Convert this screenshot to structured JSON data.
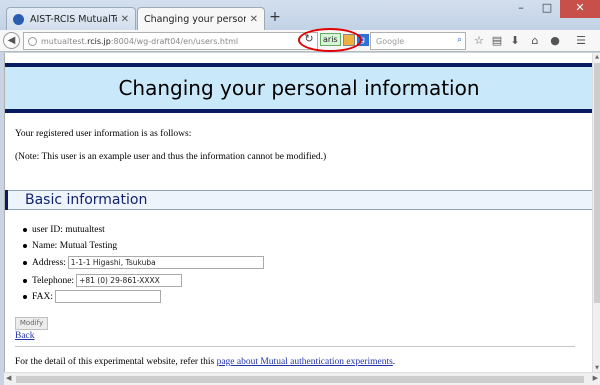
{
  "browser": {
    "tabs": [
      {
        "label": "AIST-RCIS MutualTestF...",
        "active": false
      },
      {
        "label": "Changing your personal info...",
        "active": true
      }
    ],
    "new_tab_symbol": "+",
    "url": {
      "prefix": "mutualtest.",
      "host": "rcis.jp",
      "rest": ":8004/wg-draft04/en/users.html"
    },
    "addon_label": "aris",
    "search_placeholder": "Google",
    "icons": [
      "back-icon",
      "reload-icon",
      "search-icon",
      "star-icon",
      "reading-list-icon",
      "download-icon",
      "home-icon",
      "chat-icon",
      "menu-icon"
    ]
  },
  "page": {
    "title": "Changing your personal information",
    "intro1": "Your registered user information is as follows:",
    "intro2": "(Note: This user is an example user and thus the information cannot be modified.)",
    "section_title": "Basic information",
    "fields": {
      "userid_label": "user ID: mutualtest",
      "name_label": "Name: Mutual Testing",
      "address_label": "Address:",
      "address_value": "1-1-1 Higashi, Tsukuba",
      "telephone_label": "Telephone:",
      "telephone_value": "+81 (0) 29-861-XXXX",
      "fax_label": "FAX:",
      "fax_value": ""
    },
    "modify_button": "Modify",
    "back_link": "Back",
    "footer_prefix": "For the detail of this experimental website, refer this ",
    "footer_link": "page about Mutual authentication experiments",
    "footer_suffix": "."
  },
  "colors": {
    "heading_bar": "#0a1a5e",
    "heading_bg": "#c9e8f9",
    "section_title": "#13236e",
    "link": "#2233aa",
    "highlight_circle": "#e00000"
  }
}
